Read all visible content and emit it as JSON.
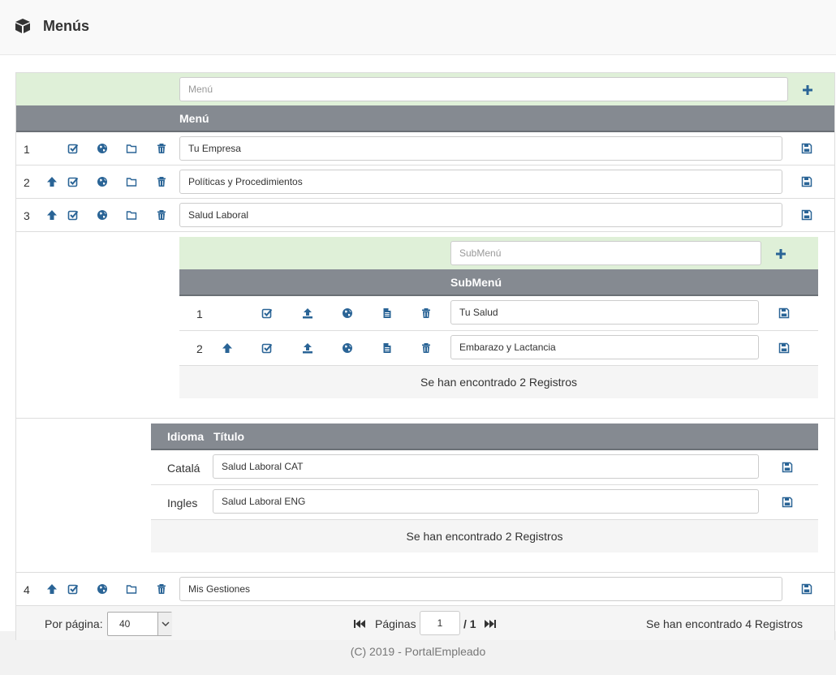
{
  "header": {
    "title": "Menús",
    "icon": "cube-icon"
  },
  "menu": {
    "new_placeholder": "Menú",
    "column_header": "Menú",
    "rows": [
      {
        "num": "1",
        "value": "Tu Empresa"
      },
      {
        "num": "2",
        "value": "Políticas y Procedimientos"
      },
      {
        "num": "3",
        "value": "Salud Laboral"
      },
      {
        "num": "4",
        "value": "Mis Gestiones"
      }
    ]
  },
  "submenu": {
    "new_placeholder": "SubMenú",
    "column_header": "SubMenú",
    "rows": [
      {
        "num": "1",
        "value": "Tu Salud"
      },
      {
        "num": "2",
        "value": "Embarazo y Lactancia"
      }
    ],
    "found_text": "Se han encontrado 2 Registros"
  },
  "translations": {
    "col_language": "Idioma",
    "col_title": "Título",
    "rows": [
      {
        "language": "Catalá",
        "value": "Salud Laboral CAT"
      },
      {
        "language": "Ingles",
        "value": "Salud Laboral ENG"
      }
    ],
    "found_text": "Se han encontrado 2 Registros"
  },
  "pagination": {
    "per_page_label": "Por página:",
    "per_page_value": "40",
    "pages_label": "Páginas",
    "current_page": "1",
    "total_pages": "/ 1",
    "found_text": "Se han encontrado 4 Registros"
  },
  "footer": {
    "copyright": "(C) 2019 - PortalEmpleado"
  },
  "colors": {
    "icon_blue": "#2a6496",
    "green_bar": "#dff0d8",
    "header_gray": "#858a91"
  }
}
